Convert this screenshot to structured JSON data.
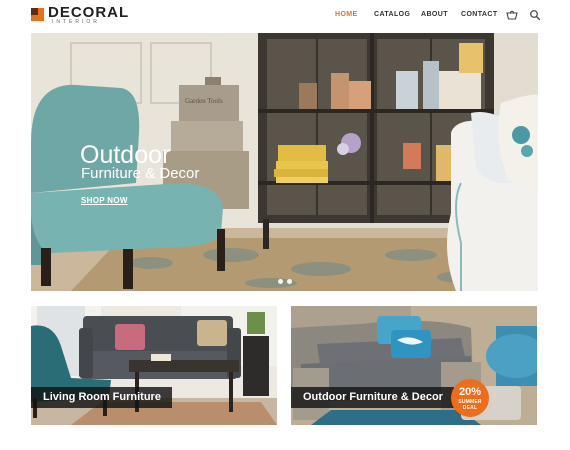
{
  "brand": {
    "name": "DECORAL",
    "tagline": "INTERIOR"
  },
  "nav": {
    "items": [
      "HOME",
      "CATALOG",
      "ABOUT",
      "CONTACT"
    ],
    "active": "HOME"
  },
  "header_icons": [
    "cart-icon",
    "search-icon"
  ],
  "hero": {
    "title": "Outdoor",
    "subtitle": "Furniture & Decor",
    "link": "SHOP NOW",
    "slides": 2,
    "active_slide": 1,
    "storage_box_lettering": "Garden Tools"
  },
  "tiles": [
    {
      "caption": "Living Room Furniture"
    },
    {
      "caption": "Outdoor Furniture & Decor",
      "badge": {
        "percent": "20%",
        "text": "SUMMER DEAL"
      }
    }
  ],
  "colors": {
    "accent": "#e8711c",
    "badge": "#ef6c18",
    "caption_bg": "#141414",
    "text_dark": "#333333"
  }
}
